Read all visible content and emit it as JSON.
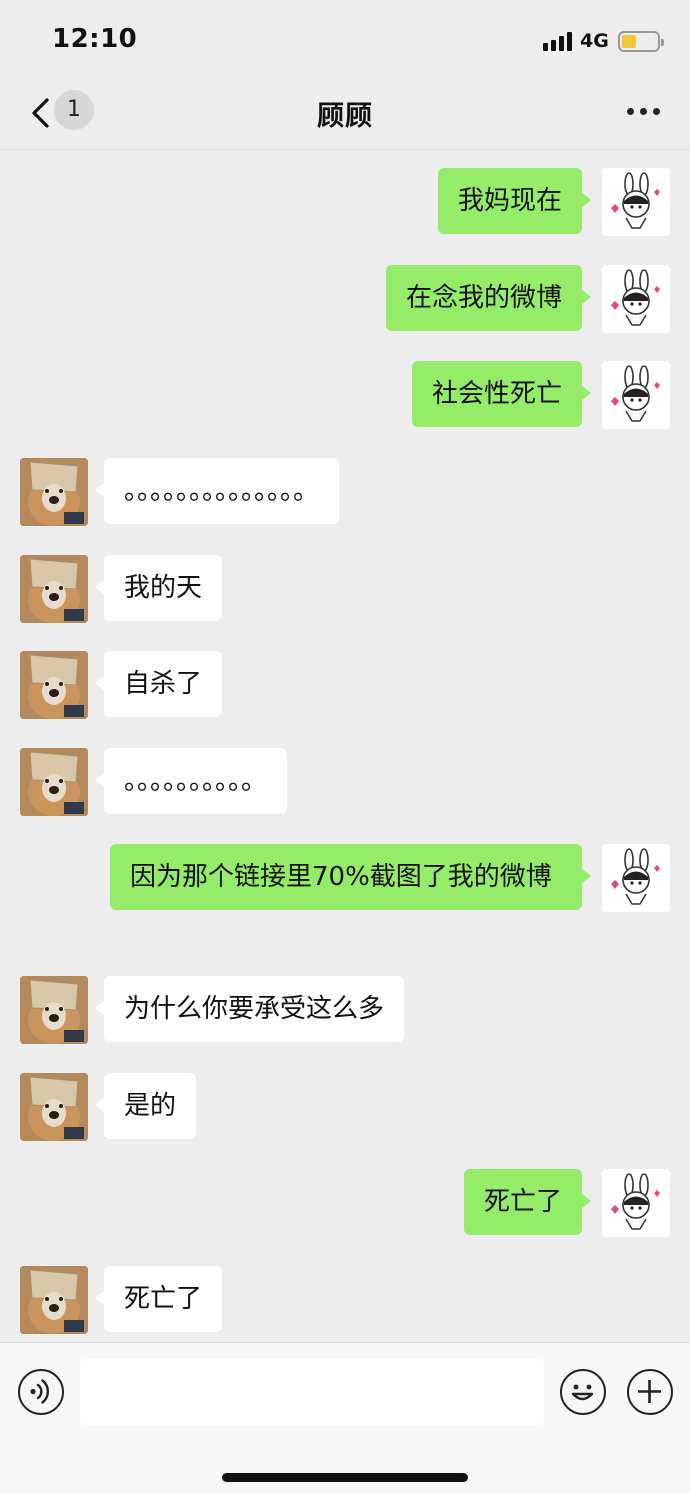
{
  "status_bar": {
    "time": "12:10",
    "network": "4G",
    "battery_level": 0.3,
    "battery_color": "#f2c63c"
  },
  "nav": {
    "back_icon": "chevron-left-icon",
    "unread_count": "1",
    "title": "顾顾",
    "more_icon": "ellipsis-icon"
  },
  "colors": {
    "outgoing_bubble": "#95ec69",
    "incoming_bubble": "#ffffff",
    "background": "#ededed"
  },
  "messages": [
    {
      "direction": "out",
      "text": "我妈现在"
    },
    {
      "direction": "out",
      "text": "在念我的微博"
    },
    {
      "direction": "out",
      "text": "社会性死亡"
    },
    {
      "direction": "in",
      "text": "。。。。。。。。。。。。。。"
    },
    {
      "direction": "in",
      "text": "我的天"
    },
    {
      "direction": "in",
      "text": "自杀了"
    },
    {
      "direction": "in",
      "text": "。。。。。。。。。。"
    },
    {
      "direction": "out",
      "text": "因为那个链接里70%截图了我的微博"
    },
    {
      "direction": "in",
      "text": "为什么你要承受这么多"
    },
    {
      "direction": "in",
      "text": "是的"
    },
    {
      "direction": "out",
      "text": "死亡了"
    },
    {
      "direction": "in",
      "text": "死亡了"
    }
  ],
  "input_bar": {
    "voice_icon": "voice-icon",
    "input_value": "",
    "emoji_icon": "emoji-icon",
    "plus_icon": "plus-icon"
  }
}
